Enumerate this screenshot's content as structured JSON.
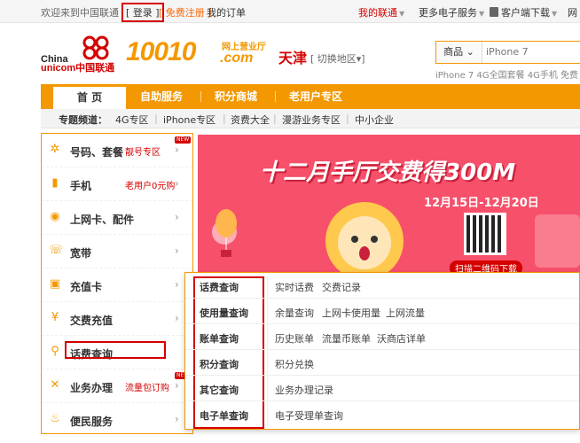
{
  "topbar": {
    "welcome": "欢迎来到中国联通",
    "login": "[ 登录 ]",
    "register": "[ 免费注册 ]",
    "orders": "我的订单",
    "my_unicom": "我的联通",
    "more_services": "更多电子服务",
    "client_download": "客户端下载",
    "net_prefix": "网"
  },
  "header": {
    "logo_line1": "China",
    "logo_line2": "unicom中国联通",
    "brand": "10010",
    "brand_sub": "网上营业厅",
    "brand_com": ".com",
    "city": "天津",
    "switch_city": "[ 切换地区▾]",
    "search_category": "商品 ⌄",
    "search_placeholder": "iPhone 7",
    "hot_words": "iPhone 7  4G全国套餐  4G手机  免费"
  },
  "nav": {
    "items": [
      "首  页",
      "自助服务",
      "积分商城",
      "老用户专区"
    ]
  },
  "channel": {
    "label": "专题频道：",
    "items": [
      "4G专区",
      "iPhone专区",
      "资费大全",
      "漫游业务专区",
      "中小企业"
    ]
  },
  "sidebar": {
    "items": [
      {
        "label": "号码、套餐",
        "extra": "靓号专区",
        "icon": "gear-icon",
        "badge": "NEW"
      },
      {
        "label": "手机",
        "extra": "老用户0元购",
        "icon": "phone-icon",
        "badge": ""
      },
      {
        "label": "上网卡、配件",
        "extra": "",
        "icon": "signal-icon",
        "badge": ""
      },
      {
        "label": "宽带",
        "extra": "",
        "icon": "broadband-icon",
        "badge": ""
      },
      {
        "label": "充值卡",
        "extra": "",
        "icon": "card-icon",
        "badge": ""
      },
      {
        "label": "交费充值",
        "extra": "",
        "icon": "yen-icon",
        "badge": ""
      },
      {
        "label": "话费查询",
        "extra": "",
        "icon": "search-icon",
        "badge": ""
      },
      {
        "label": "业务办理",
        "extra": "流量包订购",
        "icon": "tools-icon",
        "badge": "NEW"
      },
      {
        "label": "便民服务",
        "extra": "",
        "icon": "service-icon",
        "badge": ""
      }
    ]
  },
  "banner": {
    "title": "十二月手厅交费得300M",
    "date": "12月15日-12月20日",
    "scan": "扫描二维码下载"
  },
  "dropdown": {
    "rows": [
      {
        "category": "话费查询",
        "links": [
          "实时话费",
          "交费记录"
        ]
      },
      {
        "category": "使用量查询",
        "links": [
          "余量查询",
          "上网卡使用量",
          "上网流量"
        ]
      },
      {
        "category": "账单查询",
        "links": [
          "历史账单",
          "流量币账单",
          "沃商店详单"
        ]
      },
      {
        "category": "积分查询",
        "links": [
          "积分兑换"
        ]
      },
      {
        "category": "其它查询",
        "links": [
          "业务办理记录"
        ]
      },
      {
        "category": "电子单查询",
        "links": [
          "电子受理单查询"
        ]
      }
    ]
  },
  "colors": {
    "accent": "#f39800",
    "brand_red": "#d40000",
    "banner_bg": "#f7506a"
  }
}
